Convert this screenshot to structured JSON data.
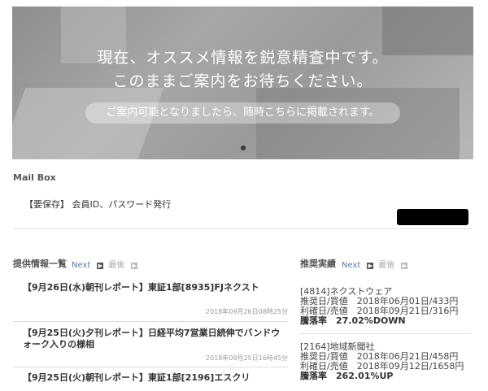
{
  "hero": {
    "line1": "現在、オススメ情報を鋭意精査中です。",
    "line2": "このままご案内をお待ちください。",
    "pill": "ご案内可能となりましたら、随時こちらに掲載されます。"
  },
  "mailbox": {
    "title": "Mail Box",
    "item": "【要保存】 会員ID、パスワード発行"
  },
  "info": {
    "title": "提供情報一覧",
    "next": "Next",
    "back": "最後",
    "items": [
      {
        "title": "【9月26日(水)朝刊レポート】東証1部[8935]FJネクスト",
        "date": "2018年09月26日08時25分"
      },
      {
        "title": "【9月25日(火)夕刊レポート】日経平均7営業日続伸でバンドウォーク入りの様相",
        "date": "2018年09月25日16時45分"
      },
      {
        "title": "【9月25日(火)朝刊レポート】東証1部[2196]エスクリ",
        "date": ""
      }
    ]
  },
  "recommend": {
    "title": "推奨実績",
    "next": "Next",
    "back": "最後",
    "items": [
      {
        "name": "[4814]ネクストウェア",
        "buy": "推奨日/買値　2018年06月01日/433円",
        "sell": "利確日/売値　2018年09月21日/316円",
        "rate": "騰落率　27.02%DOWN"
      },
      {
        "name": "[2164]地域新聞社",
        "buy": "推奨日/買値　2018年06月21日/458円",
        "sell": "利確日/売値　2018年09月12日/1658円",
        "rate": "騰落率　262.01%UP"
      }
    ]
  }
}
